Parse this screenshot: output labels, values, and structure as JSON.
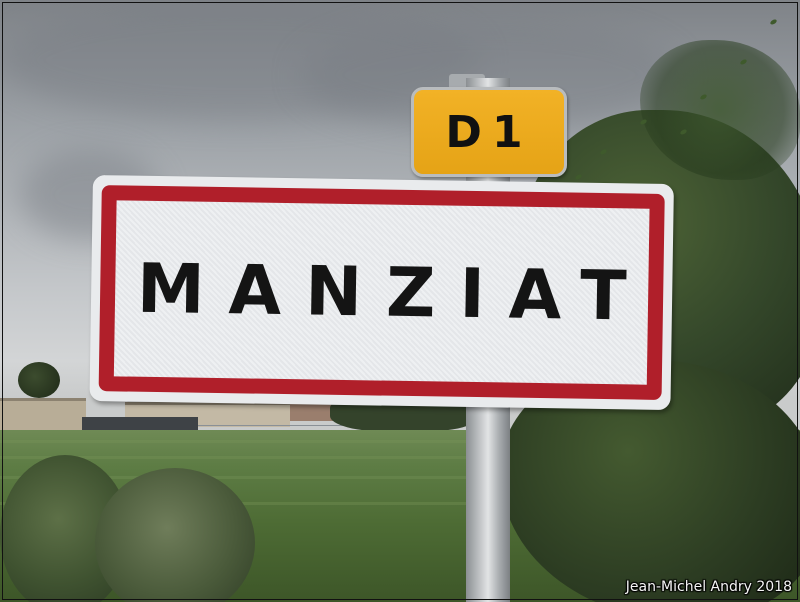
{
  "route_sign": {
    "text": "D1"
  },
  "town_sign": {
    "name": "MANZIAT"
  },
  "photo_credit": "Jean-Michel Andry 2018",
  "colors": {
    "route_sign_bg": "#f2b226",
    "town_sign_border": "#b01f2a",
    "town_sign_bg": "#eef0f2",
    "sky": "#c4c7ca",
    "field": "#5e7d45"
  }
}
